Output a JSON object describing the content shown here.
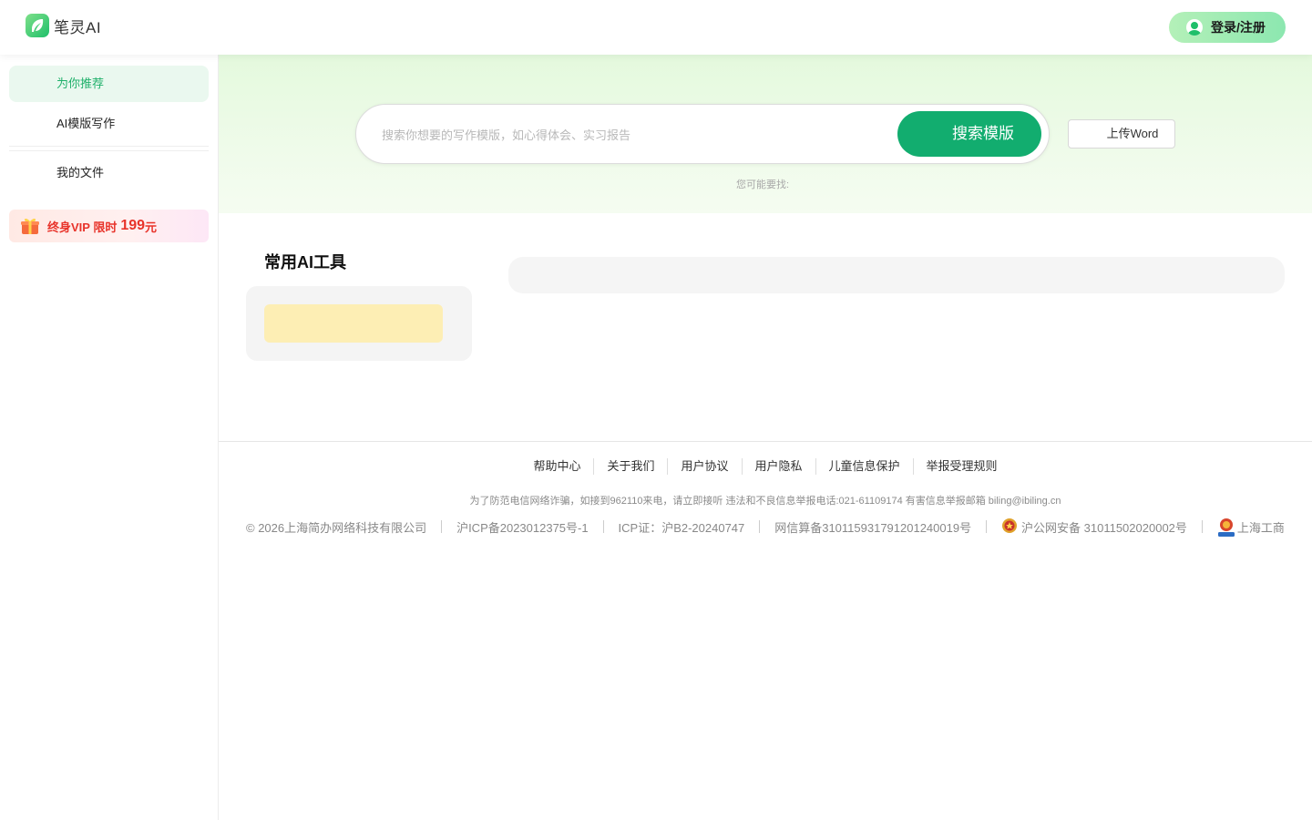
{
  "header": {
    "app_name": "笔灵AI",
    "login_label": "登录/注册"
  },
  "sidebar": {
    "items": [
      {
        "label": "为你推荐"
      },
      {
        "label": "AI模版写作"
      },
      {
        "label": "我的文件"
      }
    ],
    "vip": {
      "text": "终身VIP 限时",
      "price": "199",
      "unit": "元"
    }
  },
  "hero": {
    "search_placeholder": "搜索你想要的写作模版，如心得体会、实习报告",
    "search_button": "搜索模版",
    "upload_button": "上传Word",
    "maybe_label": "您可能要找:"
  },
  "tools": {
    "title": "常用AI工具"
  },
  "footer": {
    "links": [
      "帮助中心",
      "关于我们",
      "用户协议",
      "用户隐私",
      "儿童信息保护",
      "举报受理规则"
    ],
    "notice": "为了防范电信网络诈骗，如接到962110来电，请立即接听 违法和不良信息举报电话:021-61109174 有害信息举报邮箱 biling@ibiling.cn",
    "legal": [
      "© 2026上海简办网络科技有限公司",
      "沪ICP备2023012375号-1",
      "ICP证：沪B2-20240747",
      "网信算备310115931791201240019号",
      "沪公网安备 31011502020002号",
      "上海工商"
    ]
  },
  "colors": {
    "brand_green": "#12ad6f",
    "active_item_bg": "#eaf8ef",
    "vip_red": "#e8332a"
  }
}
